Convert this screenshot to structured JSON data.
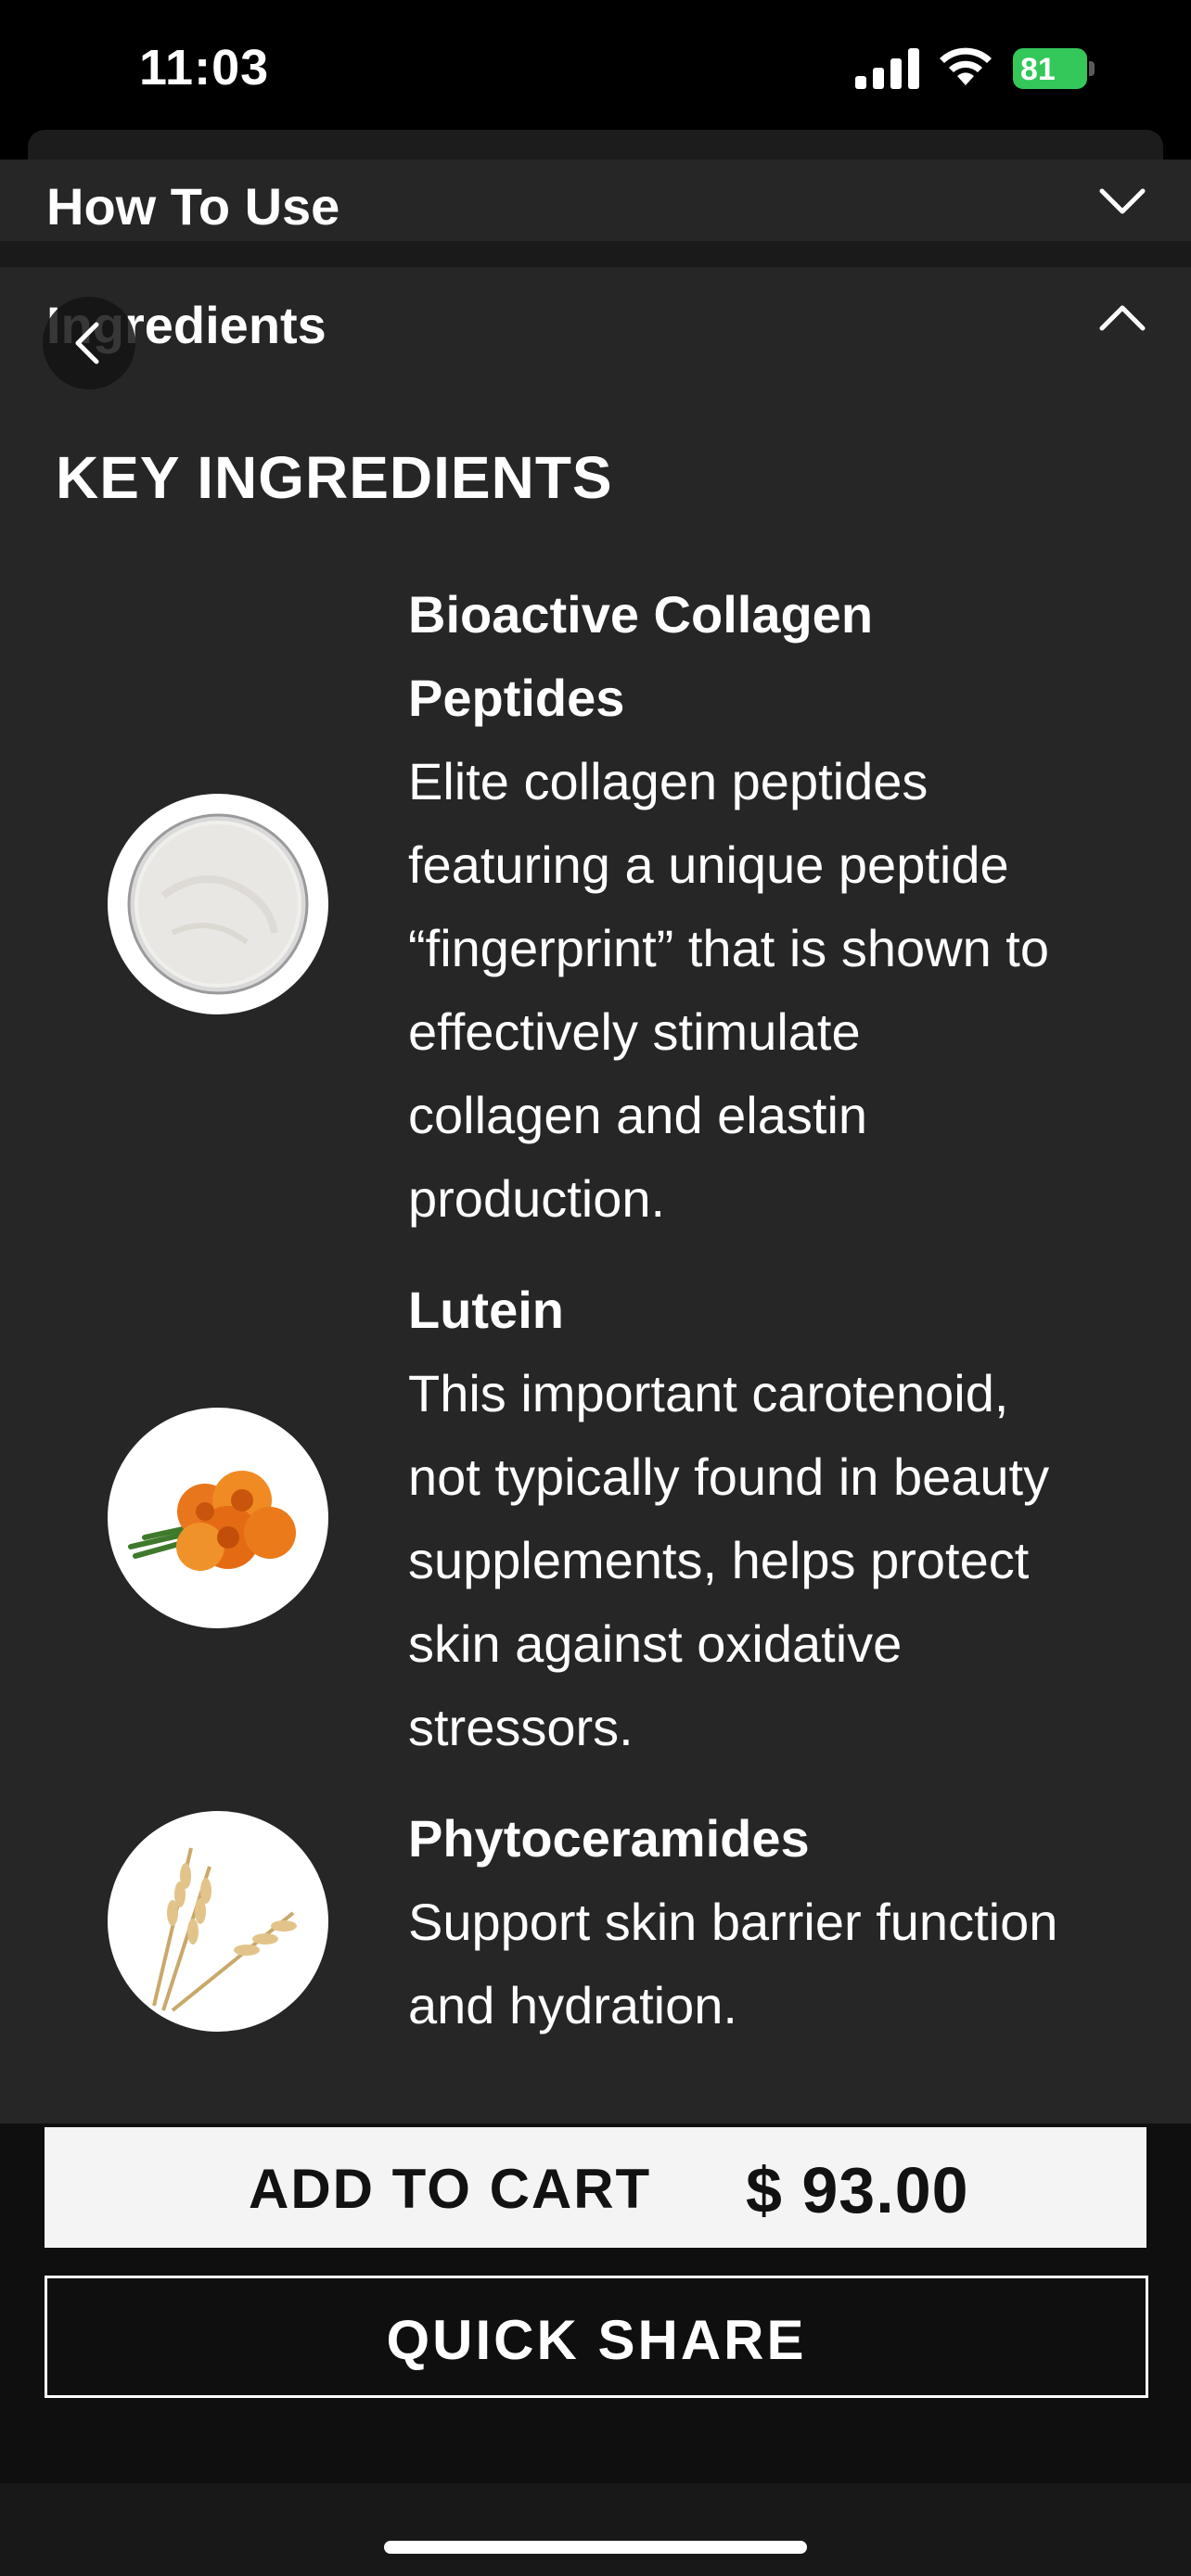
{
  "status_bar": {
    "time": "11:03",
    "battery_level": "81",
    "battery_color": "#34c759"
  },
  "accordions": {
    "how_to_use": {
      "label": "How To Use",
      "icon": "chevron-down-icon",
      "expanded": false
    },
    "ingredients": {
      "label": "Ingredients",
      "icon": "chevron-up-icon",
      "expanded": true
    }
  },
  "back_button": {
    "icon": "chevron-left-icon"
  },
  "key_ingredients": {
    "heading": "KEY INGREDIENTS",
    "items": [
      {
        "name_line1": "Bioactive Collagen",
        "name_line2": "Peptides",
        "desc_lines": [
          "Elite collagen peptides",
          "featuring a unique peptide",
          "“fingerprint” that is shown to",
          "effectively stimulate",
          "collagen and elastin",
          "production."
        ],
        "image": "collagen-powder-image"
      },
      {
        "name_line1": "Lutein",
        "desc_lines": [
          "This important carotenoid,",
          "not typically found in beauty",
          "supplements, helps protect",
          "skin against oxidative",
          "stressors."
        ],
        "image": "marigold-flowers-image"
      },
      {
        "name_line1": "Phytoceramides",
        "desc_lines": [
          "Support skin barrier function",
          "and hydration."
        ],
        "image": "wheat-stalks-image"
      }
    ]
  },
  "actions": {
    "add_to_cart_label": "ADD TO CART",
    "price": "$ 93.00",
    "quick_share_label": "QUICK SHARE"
  }
}
